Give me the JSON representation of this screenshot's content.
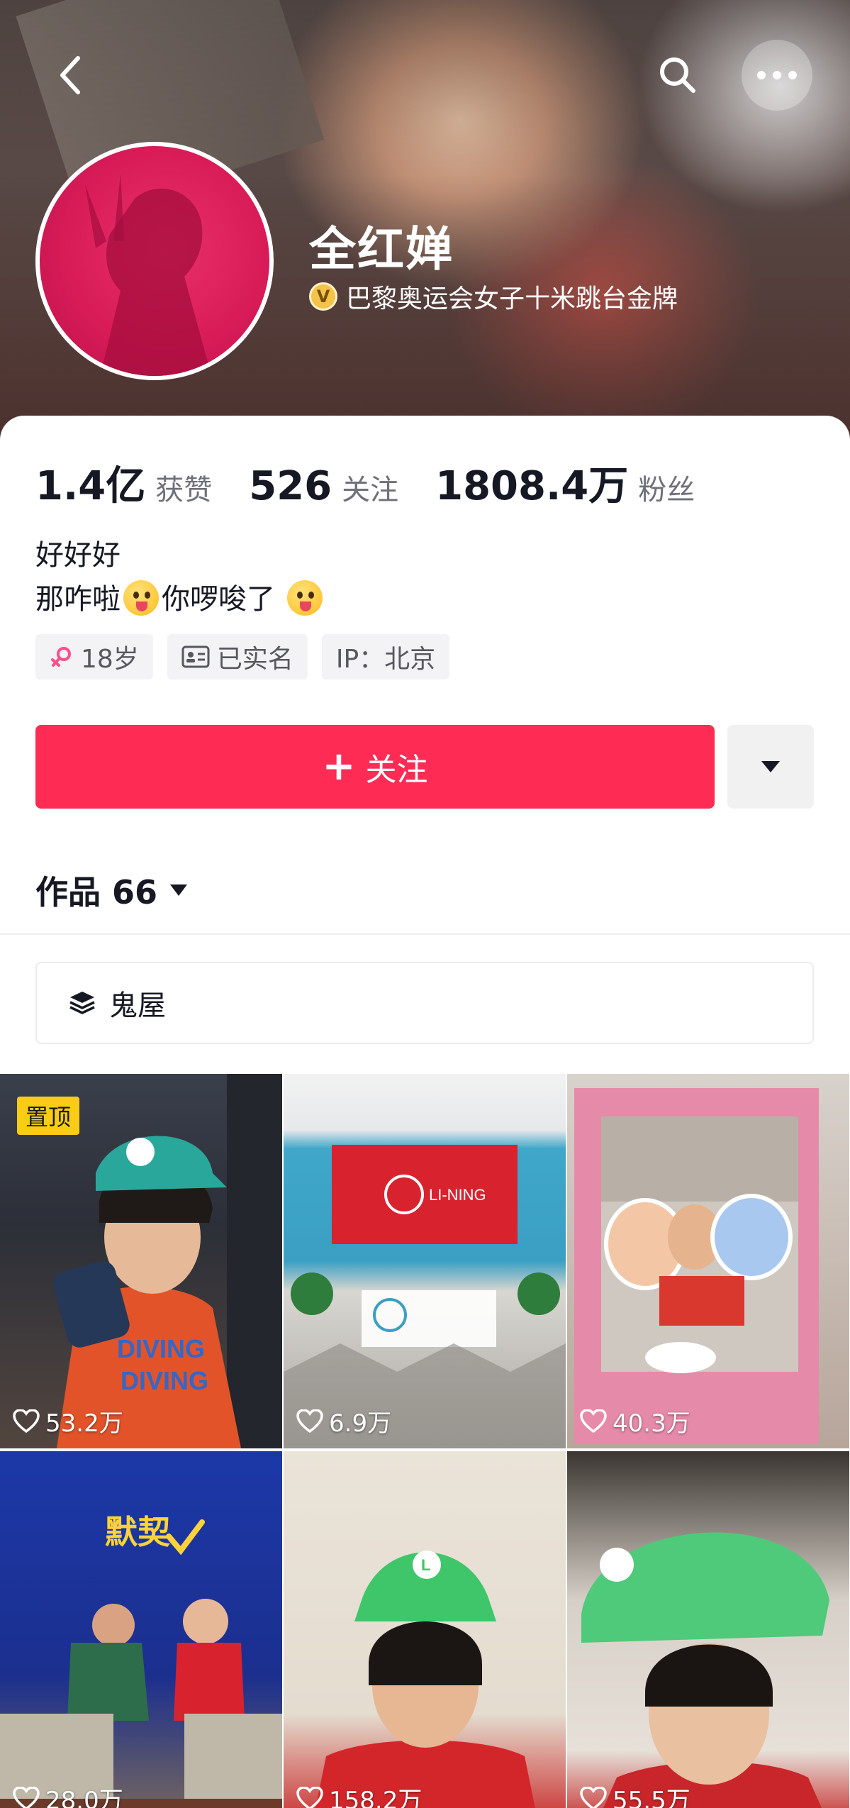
{
  "header": {
    "name": "全红婵",
    "verification": "巴黎奥运会女子十米跳台金牌",
    "verify_badge": "V"
  },
  "stats": [
    {
      "value": "1.4亿",
      "label": "获赞"
    },
    {
      "value": "526",
      "label": "关注"
    },
    {
      "value": "1808.4万",
      "label": "粉丝"
    }
  ],
  "bio": {
    "line1": "好好好",
    "line2_a": "那咋啦",
    "line2_b": "你啰唆了"
  },
  "tags": {
    "age": "18岁",
    "verified": "已实名",
    "ip": "IP：北京"
  },
  "actions": {
    "follow_label": "关注",
    "follow_plus": "+"
  },
  "works": {
    "label": "作品 66"
  },
  "collection": {
    "label": "鬼屋"
  },
  "videos": [
    {
      "likes": "53.2万",
      "pinned": "置顶"
    },
    {
      "likes": "6.9万"
    },
    {
      "likes": "40.3万"
    },
    {
      "likes": "28.0万"
    },
    {
      "likes": "158.2万"
    },
    {
      "likes": "55.5万"
    }
  ],
  "thumb_texts": {
    "t4_title": "默契"
  },
  "colors": {
    "accent": "#fe2c55",
    "pin_badge": "#facc15",
    "avatar": "#d91c58"
  }
}
